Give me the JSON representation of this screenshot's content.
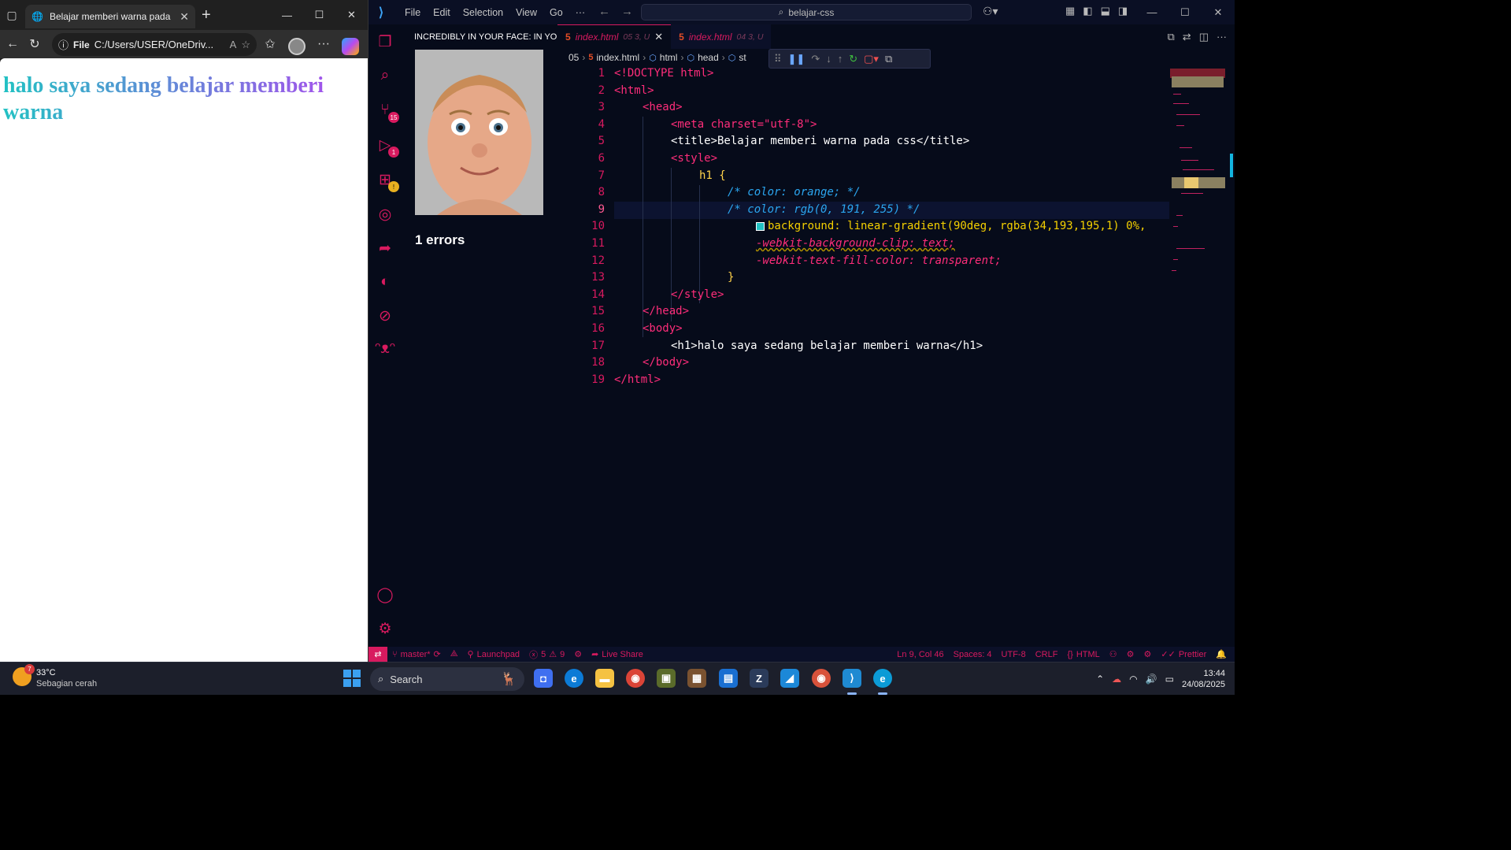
{
  "browser": {
    "tab_title": "Belajar memberi warna pada css",
    "address_label": "File",
    "address_value": "C:/Users/USER/OneDriv...",
    "page_heading": "halo saya sedang belajar memberi warna"
  },
  "vscode": {
    "menu": [
      "File",
      "Edit",
      "Selection",
      "View",
      "Go",
      "···"
    ],
    "command_center": "belajar-css",
    "side_panel_title": "INCREDIBLY IN YOUR FACE: IN YOUR...",
    "side_panel_errors": "1 errors",
    "activity_badges": {
      "source_control": "15",
      "run": "1"
    },
    "tabs": [
      {
        "name": "index.html",
        "meta": "05 3, U",
        "active": true
      },
      {
        "name": "index.html",
        "meta": "04 3, U",
        "active": false
      }
    ],
    "breadcrumb": [
      "05",
      "index.html",
      "html",
      "head",
      "st"
    ],
    "code_lines": [
      "<!DOCTYPE html>",
      "<html>",
      "<head>",
      "<meta charset=\"utf-8\">",
      "<title>Belajar memberi warna pada css</title>",
      "<style>",
      "h1 {",
      "/* color: orange; */",
      "/* color: rgb(0, 191, 255) */",
      "background: linear-gradient(90deg, rgba(34,193,195,1) 0%,",
      "-webkit-background-clip: text;",
      "-webkit-text-fill-color: transparent;",
      "}",
      "</style>",
      "</head>",
      "<body>",
      "<h1>halo saya sedang belajar memberi warna</h1>",
      "</body>",
      "</html>"
    ],
    "current_line": 9,
    "status": {
      "branch": "master*",
      "launchpad": "Launchpad",
      "errors": "5",
      "warnings": "9",
      "liveshare": "Live Share",
      "position": "Ln 9, Col 46",
      "spaces": "Spaces: 4",
      "encoding": "UTF-8",
      "eol": "CRLF",
      "language": "HTML",
      "formatter": "Prettier"
    }
  },
  "taskbar": {
    "temperature": "33°C",
    "weather": "Sebagian cerah",
    "weather_badge": "7",
    "search_placeholder": "Search",
    "time": "13:44",
    "date": "24/08/2025"
  },
  "colors": {
    "accent": "#d81a5f",
    "editor_bg": "#060b1a",
    "gradient_start": "#22c1c3",
    "gradient_end": "#b048f0"
  }
}
